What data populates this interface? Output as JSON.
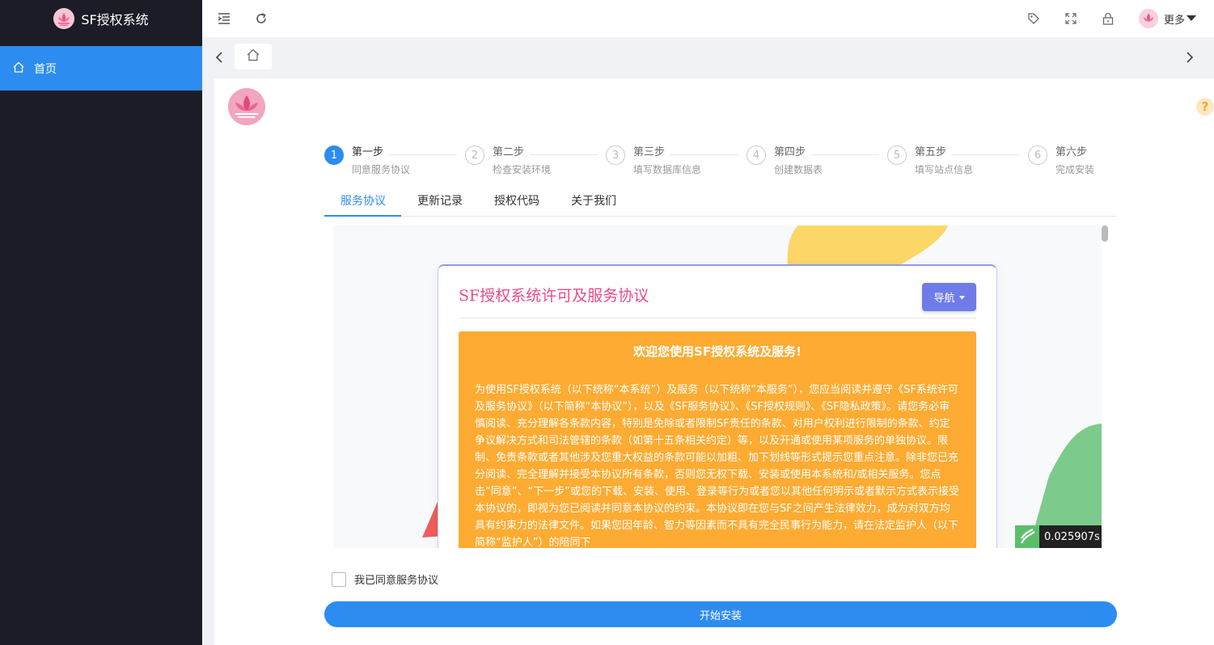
{
  "brand": {
    "title": "SF授权系统"
  },
  "sidebar": {
    "items": [
      {
        "label": "首页",
        "icon": "home-icon"
      }
    ]
  },
  "header": {
    "more_label": "更多"
  },
  "steps": [
    {
      "num": "1",
      "title": "第一步",
      "desc": "同意服务协议",
      "active": true
    },
    {
      "num": "2",
      "title": "第二步",
      "desc": "检查安装环境",
      "active": false
    },
    {
      "num": "3",
      "title": "第三步",
      "desc": "填写数据库信息",
      "active": false
    },
    {
      "num": "4",
      "title": "第四步",
      "desc": "创建数据表",
      "active": false
    },
    {
      "num": "5",
      "title": "第五步",
      "desc": "填写站点信息",
      "active": false
    },
    {
      "num": "6",
      "title": "第六步",
      "desc": "完成安装",
      "active": false
    }
  ],
  "tabs": [
    {
      "label": "服务协议",
      "active": true
    },
    {
      "label": "更新记录",
      "active": false
    },
    {
      "label": "授权代码",
      "active": false
    },
    {
      "label": "关于我们",
      "active": false
    }
  ],
  "agreement": {
    "title": "SF授权系统许可及服务协议",
    "nav_label": "导航",
    "welcome": "欢迎您使用SF授权系统及服务!",
    "body": "为使用SF授权系统（以下统称“本系统”）及服务（以下统称“本服务”），您应当阅读并遵守《SF系统许可及服务协议》（以下简称“本协议”），以及《SF服务协议》、《SF授权规则》、《SF隐私政策》。请您务必审慎阅读、充分理解各条款内容，特别是免除或者限制SF责任的条款、对用户权利进行限制的条款、约定争议解决方式和司法管辖的条款（如第十五条相关约定）等，以及开通或使用某项服务的单独协议。限制、免责条款或者其他涉及您重大权益的条款可能以加粗、加下划线等形式提示您重点注意。除非您已充分阅读、完全理解并接受本协议所有条款，否则您无权下载、安装或使用本系统和/或相关服务。您点击“同意”、“下一步”或您的下载、安装、使用、登录等行为或者您以其他任何明示或者默示方式表示接受本协议的，即视为您已阅读并同意本协议的约束。本协议即在您与SF之间产生法律效力，成为对双方均具有约束力的法律文件。如果您因年龄、智力等因素而不具有完全民事行为能力，请在法定监护人（以下简称“监护人”）的陪同下"
  },
  "timer": "0.025907s",
  "agree_label": "我已同意服务协议",
  "submit_label": "开始安装",
  "colors": {
    "primary": "#2d8cf0",
    "sidebar": "#1c1c26",
    "orange": "#fdab32",
    "title_pink": "#e84b8a",
    "nav_btn": "#6f7ce8"
  }
}
